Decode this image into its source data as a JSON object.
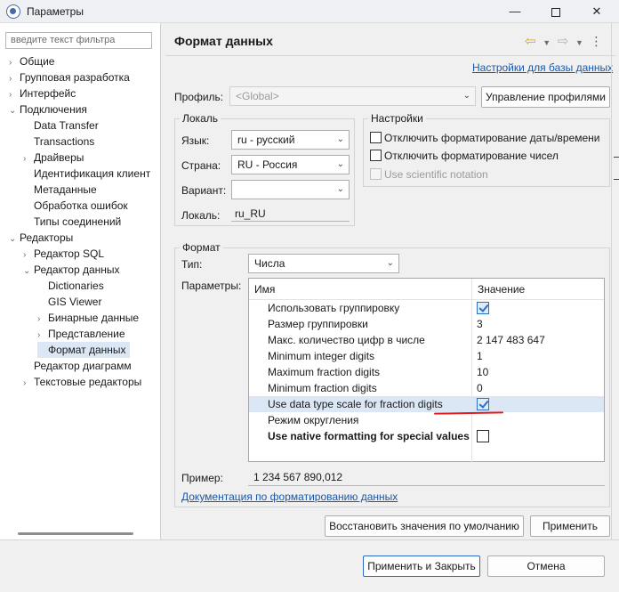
{
  "window": {
    "title": "Параметры"
  },
  "left": {
    "filter_placeholder": "введите текст фильтра",
    "tree": [
      {
        "label": "Общие",
        "tw": "›"
      },
      {
        "label": "Групповая разработка",
        "tw": "›"
      },
      {
        "label": "Интерфейс",
        "tw": "›"
      },
      {
        "label": "Подключения",
        "tw": "⌄"
      },
      {
        "label": "Data Transfer",
        "tw": ""
      },
      {
        "label": "Transactions",
        "tw": ""
      },
      {
        "label": "Драйверы",
        "tw": "›"
      },
      {
        "label": "Идентификация клиент",
        "tw": ""
      },
      {
        "label": "Метаданные",
        "tw": ""
      },
      {
        "label": "Обработка ошибок",
        "tw": ""
      },
      {
        "label": "Типы соединений",
        "tw": ""
      },
      {
        "label": "Редакторы",
        "tw": "⌄"
      },
      {
        "label": "Редактор SQL",
        "tw": "›"
      },
      {
        "label": "Редактор данных",
        "tw": "⌄"
      },
      {
        "label": "Dictionaries",
        "tw": ""
      },
      {
        "label": "GIS Viewer",
        "tw": ""
      },
      {
        "label": "Бинарные данные",
        "tw": "›"
      },
      {
        "label": "Представление",
        "tw": "›"
      },
      {
        "label": "Формат данных",
        "tw": ""
      },
      {
        "label": "Редактор диаграмм",
        "tw": ""
      },
      {
        "label": "Текстовые редакторы",
        "tw": "›"
      }
    ]
  },
  "page": {
    "title": "Формат данных",
    "db_settings_link": "Настройки для базы данных",
    "profile_label": "Профиль:",
    "profile_value": "<Global>",
    "manage_profiles": "Управление профилями",
    "locale": {
      "title": "Локаль",
      "language_label": "Язык:",
      "language_value": "ru - русский",
      "country_label": "Страна:",
      "country_value": "RU - Россия",
      "variant_label": "Вариант:",
      "variant_value": "",
      "locale_label": "Локаль:",
      "locale_value": "ru_RU"
    },
    "settings": {
      "title": "Настройки",
      "disable_date_format": "Отключить форматирование даты/времени",
      "disable_number_format": "Отключить форматирование чисел",
      "use_scientific": "Use scientific notation"
    },
    "format": {
      "title": "Формат",
      "type_label": "Тип:",
      "type_value": "Числа",
      "params_label": "Параметры:",
      "col_name": "Имя",
      "col_value": "Значение",
      "rows": [
        {
          "name": "Использовать группировку",
          "value": "",
          "check": "on"
        },
        {
          "name": "Размер группировки",
          "value": "3",
          "check": ""
        },
        {
          "name": "Макс. количество цифр в числе",
          "value": "2 147 483 647",
          "check": ""
        },
        {
          "name": "Minimum integer digits",
          "value": "1",
          "check": ""
        },
        {
          "name": "Maximum fraction digits",
          "value": "10",
          "check": ""
        },
        {
          "name": "Minimum fraction digits",
          "value": "0",
          "check": ""
        },
        {
          "name": "Use data type scale for fraction digits",
          "value": "",
          "check": "on"
        },
        {
          "name": "Режим округления",
          "value": "",
          "check": ""
        },
        {
          "name": "Use native formatting for special values",
          "value": "",
          "check": "off"
        }
      ],
      "sample_label": "Пример:",
      "sample_value": "1 234 567 890,012",
      "docs_link": "Документация по форматированию данных"
    },
    "restore_defaults": "Восстановить значения по умолчанию",
    "apply": "Применить"
  },
  "footer": {
    "apply_close": "Применить и Закрыть",
    "cancel": "Отмена"
  },
  "colors": {
    "accent": "#2d69c4",
    "selection": "#dbe7f5",
    "link": "#1b57a8",
    "mark": "#e11d1d"
  }
}
